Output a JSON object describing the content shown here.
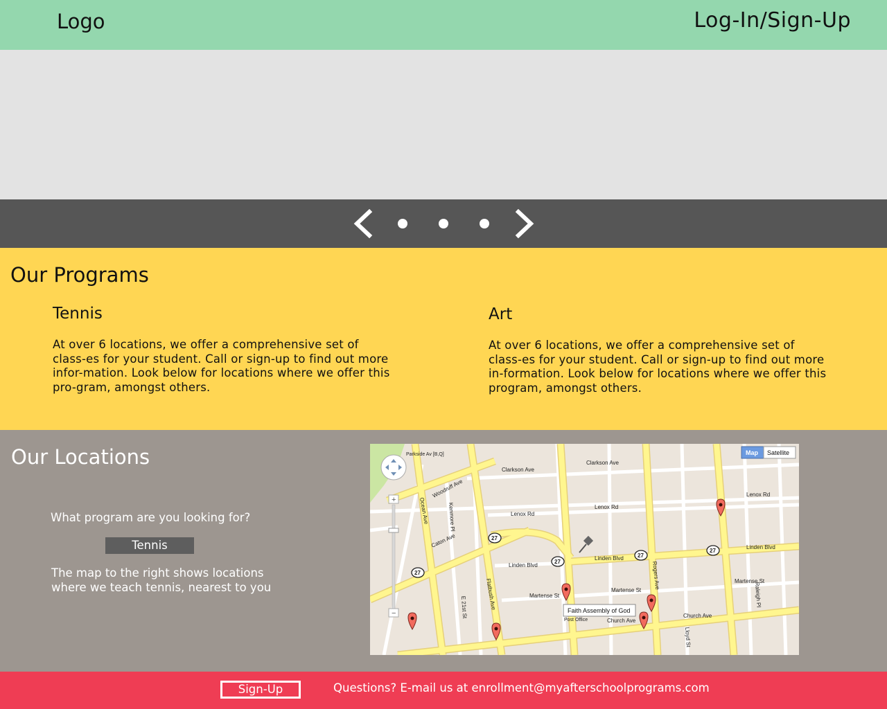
{
  "header": {
    "logo": "Logo",
    "login": "Log-In/Sign-Up"
  },
  "carousel": {
    "prev_icon": "chevron-left-icon",
    "next_icon": "chevron-right-icon",
    "dot_count": 3
  },
  "programs": {
    "title": "Our Programs",
    "items": [
      {
        "name": "Tennis",
        "description": "At over 6 locations, we offer a comprehensive set of class-es for your student. Call or sign-up to find out more infor-mation. Look below for locations where we offer this pro-gram, amongst others."
      },
      {
        "name": "Art",
        "description": "At over 6 locations, we offer a comprehensive set of class-es for your student. Call or sign-up to find out more in-formation. Look below for locations where we offer this program, amongst others."
      }
    ]
  },
  "locations": {
    "title": "Our Locations",
    "question": "What program are you looking for?",
    "selected_program": "Tennis",
    "map_note": "The map to the right shows locations where we teach tennis, nearest to you"
  },
  "map": {
    "type_map": "Map",
    "type_satellite": "Satellite",
    "tooltip": "Faith Assembly of God",
    "streets": {
      "clarkson1": "Clarkson Ave",
      "clarkson2": "Clarkson Ave",
      "lenox1": "Lenox Rd",
      "lenox2": "Lenox Rd",
      "lenox3": "Lenox Rd",
      "linden1": "Linden Blvd",
      "linden2": "Linden Blvd",
      "linden3": "Linden Blvd",
      "martense1": "Martense St",
      "martense2": "Martense St",
      "martense3": "Martense St",
      "church1": "Church Ave",
      "church2": "Church Ave",
      "ocean": "Ocean Ave",
      "flatbush": "Flatbush Ave",
      "rogers": "Rogers Ave",
      "woodruff": "Woodruff Ave",
      "caton": "Caton Ave",
      "kenmore": "Kenmore Pl",
      "e21": "E 21st St",
      "lloyd": "Lloyd St",
      "raleigh": "Raleigh Pl",
      "parkside": "Parkside Av [B,Q]",
      "post_office": "Post Office",
      "route": "27"
    },
    "colors": {
      "land": "#ece5dc",
      "road": "#fff68f",
      "road_border": "#e8d36a",
      "street": "#ffffff",
      "park": "#cbe6a3",
      "pin": "#f26b5e"
    }
  },
  "footer": {
    "signup": "Sign-Up",
    "contact": "Questions? E-mail us at enrollment@myafterschoolprograms.com"
  }
}
